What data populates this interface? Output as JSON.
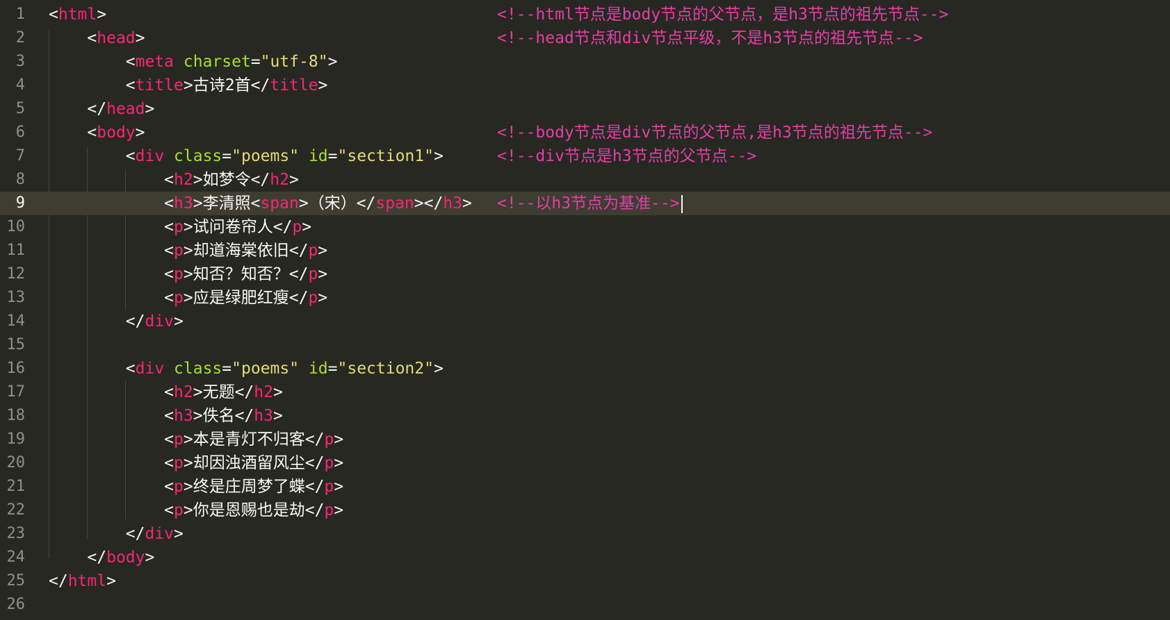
{
  "lines": [
    {
      "n": "1",
      "code": [
        [
          "p",
          "<"
        ],
        [
          "t",
          "html"
        ],
        [
          "p",
          ">"
        ]
      ],
      "comment": "<!--html节点是body节点的父节点，是h3节点的祖先节点-->"
    },
    {
      "n": "2",
      "code": [
        [
          "p",
          "    <"
        ],
        [
          "t",
          "head"
        ],
        [
          "p",
          ">"
        ]
      ],
      "comment": "<!--head节点和div节点平级，不是h3节点的祖先节点-->"
    },
    {
      "n": "3",
      "code": [
        [
          "p",
          "        <"
        ],
        [
          "t",
          "meta"
        ],
        [
          "p",
          " "
        ],
        [
          "a",
          "charset"
        ],
        [
          "p",
          "="
        ],
        [
          "s",
          "\"utf-8\""
        ],
        [
          "p",
          ">"
        ]
      ],
      "comment": ""
    },
    {
      "n": "4",
      "code": [
        [
          "p",
          "        <"
        ],
        [
          "t",
          "title"
        ],
        [
          "p",
          ">"
        ],
        [
          "x",
          "古诗2首"
        ],
        [
          "p",
          "</"
        ],
        [
          "t",
          "title"
        ],
        [
          "p",
          ">"
        ]
      ],
      "comment": ""
    },
    {
      "n": "5",
      "code": [
        [
          "p",
          "    </"
        ],
        [
          "t",
          "head"
        ],
        [
          "p",
          ">"
        ]
      ],
      "comment": ""
    },
    {
      "n": "6",
      "code": [
        [
          "p",
          "    <"
        ],
        [
          "t",
          "body"
        ],
        [
          "p",
          ">"
        ]
      ],
      "comment": "<!--body节点是div节点的父节点,是h3节点的祖先节点-->"
    },
    {
      "n": "7",
      "code": [
        [
          "p",
          "        <"
        ],
        [
          "t",
          "div"
        ],
        [
          "p",
          " "
        ],
        [
          "a",
          "class"
        ],
        [
          "p",
          "="
        ],
        [
          "s",
          "\"poems\""
        ],
        [
          "p",
          " "
        ],
        [
          "a",
          "id"
        ],
        [
          "p",
          "="
        ],
        [
          "s",
          "\"section1\""
        ],
        [
          "p",
          ">"
        ]
      ],
      "comment": "<!--div节点是h3节点的父节点-->"
    },
    {
      "n": "8",
      "code": [
        [
          "p",
          "            <"
        ],
        [
          "t",
          "h2"
        ],
        [
          "p",
          ">"
        ],
        [
          "x",
          "如梦令"
        ],
        [
          "p",
          "</"
        ],
        [
          "t",
          "h2"
        ],
        [
          "p",
          ">"
        ]
      ],
      "comment": ""
    },
    {
      "n": "9",
      "code": [
        [
          "p",
          "            <"
        ],
        [
          "t",
          "h3"
        ],
        [
          "p",
          ">"
        ],
        [
          "x",
          "李清照"
        ],
        [
          "p",
          "<"
        ],
        [
          "t",
          "span"
        ],
        [
          "p",
          ">"
        ],
        [
          "x",
          "（宋）"
        ],
        [
          "p",
          "</"
        ],
        [
          "t",
          "span"
        ],
        [
          "p",
          "></"
        ],
        [
          "t",
          "h3"
        ],
        [
          "p",
          ">"
        ]
      ],
      "comment": "<!--以h3节点为基准-->"
    },
    {
      "n": "10",
      "code": [
        [
          "p",
          "            <"
        ],
        [
          "t",
          "p"
        ],
        [
          "p",
          ">"
        ],
        [
          "x",
          "试问卷帘人"
        ],
        [
          "p",
          "</"
        ],
        [
          "t",
          "p"
        ],
        [
          "p",
          ">"
        ]
      ],
      "comment": ""
    },
    {
      "n": "11",
      "code": [
        [
          "p",
          "            <"
        ],
        [
          "t",
          "p"
        ],
        [
          "p",
          ">"
        ],
        [
          "x",
          "却道海棠依旧"
        ],
        [
          "p",
          "</"
        ],
        [
          "t",
          "p"
        ],
        [
          "p",
          ">"
        ]
      ],
      "comment": ""
    },
    {
      "n": "12",
      "code": [
        [
          "p",
          "            <"
        ],
        [
          "t",
          "p"
        ],
        [
          "p",
          ">"
        ],
        [
          "x",
          "知否？知否？"
        ],
        [
          "p",
          "</"
        ],
        [
          "t",
          "p"
        ],
        [
          "p",
          ">"
        ]
      ],
      "comment": ""
    },
    {
      "n": "13",
      "code": [
        [
          "p",
          "            <"
        ],
        [
          "t",
          "p"
        ],
        [
          "p",
          ">"
        ],
        [
          "x",
          "应是绿肥红瘦"
        ],
        [
          "p",
          "</"
        ],
        [
          "t",
          "p"
        ],
        [
          "p",
          ">"
        ]
      ],
      "comment": ""
    },
    {
      "n": "14",
      "code": [
        [
          "p",
          "        </"
        ],
        [
          "t",
          "div"
        ],
        [
          "p",
          ">"
        ]
      ],
      "comment": ""
    },
    {
      "n": "15",
      "code": [],
      "comment": ""
    },
    {
      "n": "16",
      "code": [
        [
          "p",
          "        <"
        ],
        [
          "t",
          "div"
        ],
        [
          "p",
          " "
        ],
        [
          "a",
          "class"
        ],
        [
          "p",
          "="
        ],
        [
          "s",
          "\"poems\""
        ],
        [
          "p",
          " "
        ],
        [
          "a",
          "id"
        ],
        [
          "p",
          "="
        ],
        [
          "s",
          "\"section2\""
        ],
        [
          "p",
          ">"
        ]
      ],
      "comment": ""
    },
    {
      "n": "17",
      "code": [
        [
          "p",
          "            <"
        ],
        [
          "t",
          "h2"
        ],
        [
          "p",
          ">"
        ],
        [
          "x",
          "无题"
        ],
        [
          "p",
          "</"
        ],
        [
          "t",
          "h2"
        ],
        [
          "p",
          ">"
        ]
      ],
      "comment": ""
    },
    {
      "n": "18",
      "code": [
        [
          "p",
          "            <"
        ],
        [
          "t",
          "h3"
        ],
        [
          "p",
          ">"
        ],
        [
          "x",
          "佚名"
        ],
        [
          "p",
          "</"
        ],
        [
          "t",
          "h3"
        ],
        [
          "p",
          ">"
        ]
      ],
      "comment": ""
    },
    {
      "n": "19",
      "code": [
        [
          "p",
          "            <"
        ],
        [
          "t",
          "p"
        ],
        [
          "p",
          ">"
        ],
        [
          "x",
          "本是青灯不归客"
        ],
        [
          "p",
          "</"
        ],
        [
          "t",
          "p"
        ],
        [
          "p",
          ">"
        ]
      ],
      "comment": ""
    },
    {
      "n": "20",
      "code": [
        [
          "p",
          "            <"
        ],
        [
          "t",
          "p"
        ],
        [
          "p",
          ">"
        ],
        [
          "x",
          "却因浊酒留风尘"
        ],
        [
          "p",
          "</"
        ],
        [
          "t",
          "p"
        ],
        [
          "p",
          ">"
        ]
      ],
      "comment": ""
    },
    {
      "n": "21",
      "code": [
        [
          "p",
          "            <"
        ],
        [
          "t",
          "p"
        ],
        [
          "p",
          ">"
        ],
        [
          "x",
          "终是庄周梦了蝶"
        ],
        [
          "p",
          "</"
        ],
        [
          "t",
          "p"
        ],
        [
          "p",
          ">"
        ]
      ],
      "comment": ""
    },
    {
      "n": "22",
      "code": [
        [
          "p",
          "            <"
        ],
        [
          "t",
          "p"
        ],
        [
          "p",
          ">"
        ],
        [
          "x",
          "你是恩赐也是劫"
        ],
        [
          "p",
          "</"
        ],
        [
          "t",
          "p"
        ],
        [
          "p",
          ">"
        ]
      ],
      "comment": ""
    },
    {
      "n": "23",
      "code": [
        [
          "p",
          "        </"
        ],
        [
          "t",
          "div"
        ],
        [
          "p",
          ">"
        ]
      ],
      "comment": ""
    },
    {
      "n": "24",
      "code": [
        [
          "p",
          "    </"
        ],
        [
          "t",
          "body"
        ],
        [
          "p",
          ">"
        ]
      ],
      "comment": ""
    },
    {
      "n": "25",
      "code": [
        [
          "p",
          "</"
        ],
        [
          "t",
          "html"
        ],
        [
          "p",
          ">"
        ]
      ],
      "comment": ""
    },
    {
      "n": "26",
      "code": [],
      "comment": ""
    }
  ],
  "current_line": "9",
  "colors": {
    "background": "#272822",
    "current_line": "#3e3d32",
    "tag": "#f92672",
    "attribute": "#a6e22e",
    "string": "#e6db74",
    "comment": "#e53da6",
    "line_number": "#90908a"
  }
}
